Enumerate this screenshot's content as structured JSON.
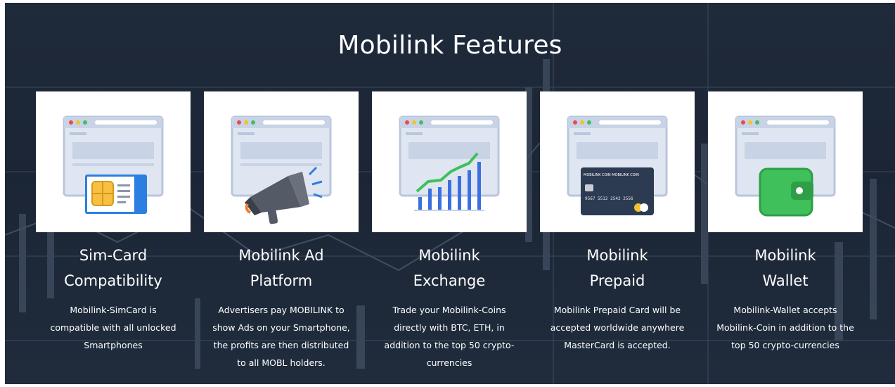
{
  "colors": {
    "background": "#1f2a3a",
    "accent_blue": "#3b6fe0",
    "accent_green": "#3fc05a",
    "text": "#ffffff"
  },
  "section": {
    "title": "Mobilink Features"
  },
  "features": [
    {
      "icon": "sim-card-icon",
      "title_lines": [
        "Sim-Card",
        "Compatibility"
      ],
      "desc_lines": [
        "Mobilink-SimCard is",
        "compatible with all unlocked",
        "Smartphones"
      ]
    },
    {
      "icon": "megaphone-icon",
      "title_lines": [
        "Mobilink Ad",
        "Platform"
      ],
      "desc_lines": [
        "Advertisers pay MOBILINK to",
        "show Ads on your Smartphone,",
        "the profits are then distributed",
        "to all MOBL holders."
      ]
    },
    {
      "icon": "exchange-chart-icon",
      "title_lines": [
        "Mobilink",
        "Exchange"
      ],
      "desc_lines": [
        "Trade your Mobilink-Coins",
        "directly with BTC, ETH, in",
        "addition to the top 50 crypto-",
        "currencies"
      ]
    },
    {
      "icon": "prepaid-card-icon",
      "title_lines": [
        "Mobilink",
        "Prepaid"
      ],
      "desc_lines": [
        "Mobilink Prepaid Card will be",
        "accepted worldwide anywhere",
        "MasterCard is accepted."
      ],
      "card_brand": "MOBILINK COIN  MOBILINK COIN",
      "card_number": "9567 5512 2542 2556"
    },
    {
      "icon": "wallet-icon",
      "title_lines": [
        "Mobilink",
        "Wallet"
      ],
      "desc_lines": [
        "Mobilink-Wallet accepts",
        "Mobilink-Coin in addition to the",
        "top 50 crypto-currencies"
      ]
    }
  ]
}
